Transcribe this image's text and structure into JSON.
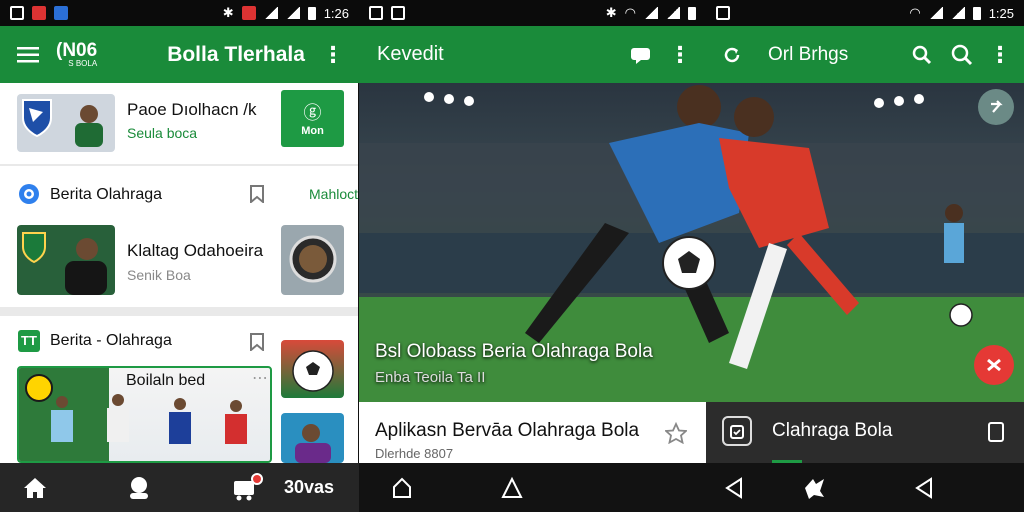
{
  "status_left": {
    "time": "1:26"
  },
  "status_right": {
    "time": "1:25"
  },
  "panel1": {
    "appbar": {
      "logo": "(N06",
      "logo_sub": "S BOLA",
      "title": "Bolla Tlerhala"
    },
    "item1": {
      "title": "Paoe Dıolhacn /k",
      "subtitle": "Seula boca",
      "button": "Mon"
    },
    "section1": {
      "title": "Berita Olahraga",
      "link": "Mahloct"
    },
    "item2": {
      "title": "Klaltag Odahoeira",
      "subtitle": "Senik Boa"
    },
    "section2": {
      "title": "Berita - Olahraga"
    },
    "item3": {
      "title": "Boilaln bed"
    },
    "bottomnav": {
      "label": "30vas"
    }
  },
  "panel2": {
    "appbar": {
      "title": "Kevedit"
    },
    "hero": {
      "title": "Bsl Olobass Beria Olahraga Bola",
      "subtitle": "Enba Teoila Ta II"
    },
    "article": {
      "title": "Aplikasn Bervāa Olahraga Bola",
      "subtitle": "Dlerhde 8807"
    }
  },
  "panel3": {
    "appbar": {
      "title": "Orl Brhgs"
    },
    "card": {
      "title": "Clahraga Bola"
    }
  },
  "colors": {
    "primary": "#1a8b3a",
    "accent": "#e53935",
    "dark": "#1b1b1b"
  }
}
